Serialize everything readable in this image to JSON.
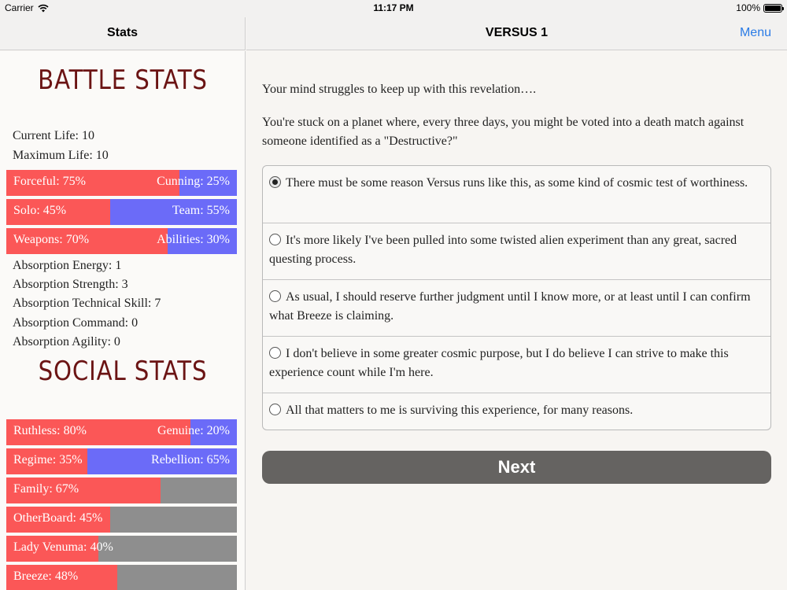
{
  "status_bar": {
    "carrier": "Carrier",
    "time": "11:17 PM",
    "battery": "100%"
  },
  "nav": {
    "left_title": "Stats",
    "right_title": "VERSUS 1",
    "menu_label": "Menu"
  },
  "battle_stats": {
    "heading": "BATTLE STATS",
    "current_life": "Current Life: 10",
    "maximum_life": "Maximum Life: 10",
    "bars": [
      {
        "left": "Forceful: 75%",
        "right": "Cunning: 25%",
        "left_pct": 75
      },
      {
        "left": "Solo: 45%",
        "right": "Team: 55%",
        "left_pct": 45
      },
      {
        "left": "Weapons: 70%",
        "right": "Abilities: 30%",
        "left_pct": 70
      }
    ],
    "absorption": [
      "Absorption Energy: 1",
      "Absorption Strength: 3",
      "Absorption Technical Skill: 7",
      "Absorption Command: 0",
      "Absorption Agility: 0"
    ]
  },
  "social_stats": {
    "heading": "SOCIAL STATS",
    "dual_bars": [
      {
        "left": "Ruthless: 80%",
        "right": "Genuine: 20%",
        "left_pct": 80
      },
      {
        "left": "Regime: 35%",
        "right": "Rebellion: 65%",
        "left_pct": 35
      }
    ],
    "single_bars": [
      {
        "label": "Family: 67%",
        "pct": 67
      },
      {
        "label": "OtherBoard: 45%",
        "pct": 45
      },
      {
        "label": "Lady Venuma: 40%",
        "pct": 40
      },
      {
        "label": "Breeze: 48%",
        "pct": 48
      }
    ]
  },
  "story": {
    "line1": "Your mind struggles to keep up with this revelation….",
    "line2": "You're stuck on a planet where, every three days, you might be voted into a death match against someone identified as a \"Destructive?\""
  },
  "choices": [
    {
      "text": "There must be some reason Versus runs like this, as some kind of cosmic test of worthiness.",
      "selected": true
    },
    {
      "text": "It's more likely I've been pulled into some twisted alien experiment than any great, sacred questing process.",
      "selected": false
    },
    {
      "text": "As usual, I should reserve further judgment until I know more, or at least until I can confirm what Breeze is claiming.",
      "selected": false
    },
    {
      "text": "I don't believe in some greater cosmic purpose, but I do believe I can strive to make this experience count while I'm here.",
      "selected": false
    },
    {
      "text": "All that matters to me is surviving this experience, for many reasons.",
      "selected": false
    }
  ],
  "next_label": "Next",
  "colors": {
    "left_fill": "#fb5757",
    "right_fill": "#6b6bf8",
    "empty": "#8e8e8e",
    "heading": "#6b1414",
    "link": "#2a7be6"
  }
}
